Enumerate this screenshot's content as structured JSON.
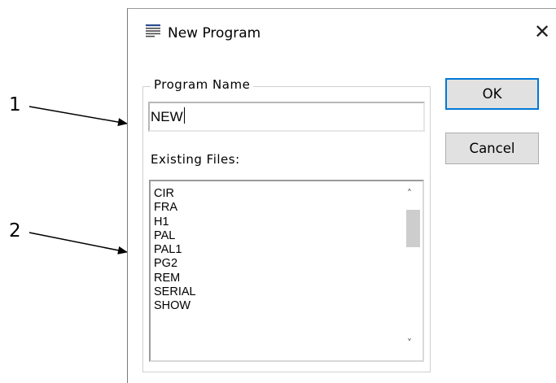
{
  "dialog": {
    "title": "New Program",
    "title_icon": "document-lines-icon",
    "close_glyph": "✕"
  },
  "program_name": {
    "label": "Program Name",
    "value": "NEW"
  },
  "existing_files": {
    "label": "Existing Files:",
    "items": [
      "CIR",
      "FRA",
      "H1",
      "PAL",
      "PAL1",
      "PG2",
      "REM",
      "SERIAL",
      "SHOW"
    ]
  },
  "buttons": {
    "ok": "OK",
    "cancel": "Cancel"
  },
  "callouts": {
    "one": "1",
    "two": "2"
  },
  "colors": {
    "focus_border": "#0078d7",
    "button_bg": "#e1e1e1"
  }
}
